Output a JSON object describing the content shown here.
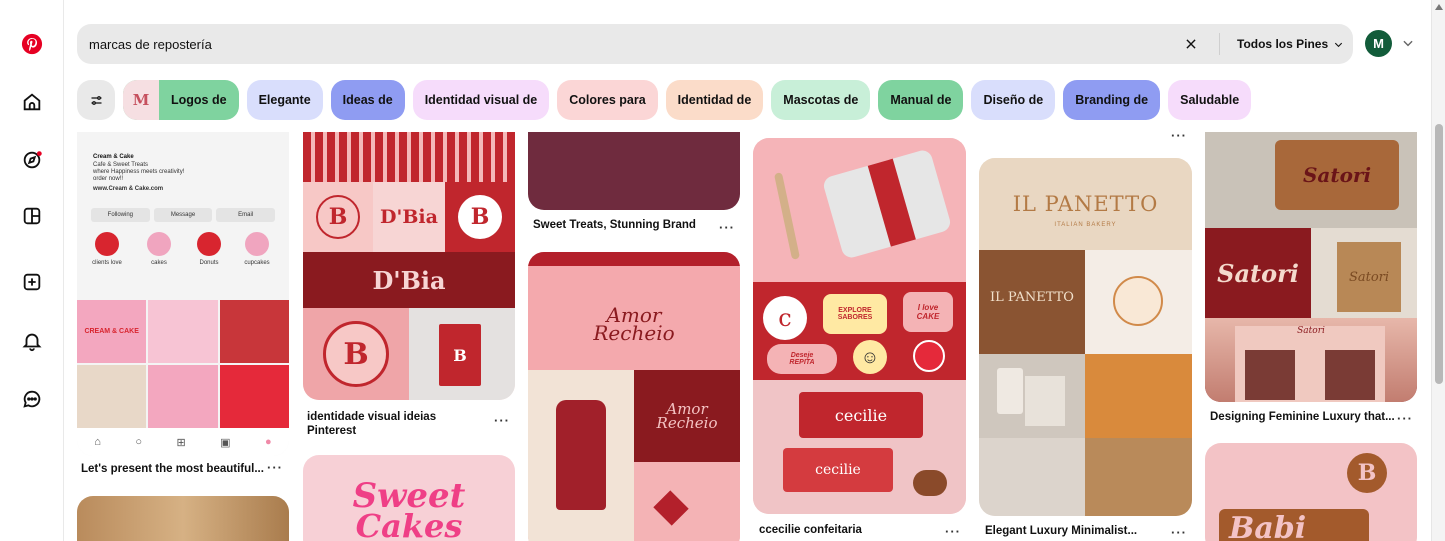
{
  "search": {
    "query": "marcas de repostería",
    "filter_label": "Todos los Pines"
  },
  "account": {
    "initial": "M"
  },
  "chips": [
    {
      "label": "Logos de",
      "color": "#7fd39f"
    },
    {
      "label": "Elegante",
      "color": "#d9defc"
    },
    {
      "label": "Ideas de",
      "color": "#8f9cf2"
    },
    {
      "label": "Identidad visual de",
      "color": "#f6dcfb"
    },
    {
      "label": "Colores para",
      "color": "#fbd6d6"
    },
    {
      "label": "Identidad de",
      "color": "#fbdcc9"
    },
    {
      "label": "Mascotas de",
      "color": "#c8efd8"
    },
    {
      "label": "Manual de",
      "color": "#7fd39f"
    },
    {
      "label": "Diseño de",
      "color": "#d9defc"
    },
    {
      "label": "Branding de",
      "color": "#8f9cf2"
    },
    {
      "label": "Saludable",
      "color": "#f6dcfb"
    }
  ],
  "chip_thumb_text": "M",
  "pins": {
    "p1": {
      "caption": "Let's present the most beautiful...",
      "profile_name": "Cream & Cake",
      "profile_bio": [
        "Cafe & Sweet Treats",
        "where Happiness meets creativity!",
        "order now!!"
      ],
      "profile_link": "www.Cream & Cake.com",
      "buttons": [
        "Following",
        "Message",
        "Email"
      ],
      "highlights": [
        "clients love",
        "cakes",
        "Donuts",
        "cupcakes"
      ],
      "tile_text": "CREAM & CAKE"
    },
    "p2": {
      "caption": "identidade visual ideias Pinterest",
      "brand": "D'Bia",
      "logo_letter": "B"
    },
    "p3": {
      "caption": "Sweet Treats, Stunning Brand"
    },
    "p4": {
      "brand_line1": "Amor",
      "brand_line2": "Recheio"
    },
    "p5": {
      "text_line1": "Sweet",
      "text_line2": "Cakes"
    },
    "p6": {
      "caption": "ccecilie confeitaria",
      "brand": "cecilie",
      "stickers": [
        "EXPLORE",
        "SABORES",
        "I love",
        "CAKE",
        "Deseje",
        "REPITA"
      ]
    },
    "p7": {
      "caption": "Elegant Luxury Minimalist...",
      "brand": "IL PANETTO",
      "subtitle": "ITALIAN BAKERY"
    },
    "p8": {
      "caption": "Designing Feminine Luxury that...",
      "brand": "Satori"
    },
    "p9": {
      "text": "Babi",
      "monogram": "B"
    }
  },
  "colors": {
    "pinterest_red": "#e60023",
    "bia_red": "#c0262d",
    "dark_red": "#8a1a1f",
    "wine": "#7a2a41",
    "brown": "#8a4a2a"
  }
}
